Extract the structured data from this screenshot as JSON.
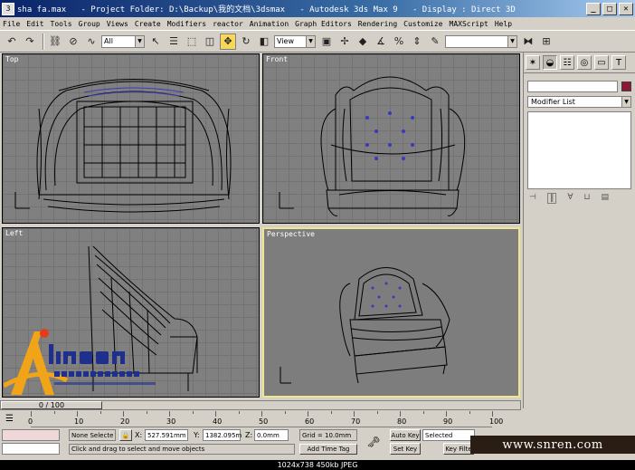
{
  "window": {
    "title": "sha fa.max   - Project Folder: D:\\Backup\\我的文档\\3dsmax   - Autodesk 3ds Max 9   - Display : Direct 3D",
    "min": "_",
    "max": "□",
    "close": "✕"
  },
  "menu": [
    "File",
    "Edit",
    "Tools",
    "Group",
    "Views",
    "Create",
    "Modifiers",
    "reactor",
    "Animation",
    "Graph Editors",
    "Rendering",
    "Customize",
    "MAXScript",
    "Help"
  ],
  "toolbar": {
    "selection_filter": "All",
    "ref_coord": "View",
    "named_selection": ""
  },
  "viewports": {
    "top": "Top",
    "front": "Front",
    "left": "Left",
    "perspective": "Perspective"
  },
  "command_panel": {
    "modifier_list": "Modifier List"
  },
  "timeline": {
    "frame": "0 / 100",
    "ticks": [
      "0",
      "10",
      "20",
      "30",
      "40",
      "50",
      "60",
      "70",
      "80",
      "90",
      "100"
    ]
  },
  "status": {
    "selection": "None Selecte",
    "x_label": "X:",
    "x_value": "527.591mm",
    "y_label": "Y:",
    "y_value": "1382.095m",
    "z_label": "Z:",
    "z_value": "0.0mm",
    "grid": "Grid = 10.0mm",
    "prompt": "Click and drag to select and move objects",
    "add_time_tag": "Add Time Tag",
    "auto_key": "Auto Key",
    "set_key": "Set Key",
    "key_mode": "Selected",
    "key_filters": "Key Filte"
  },
  "watermark": {
    "site": "www.snren.com"
  },
  "caption": "1024x738  450kb  JPEG"
}
